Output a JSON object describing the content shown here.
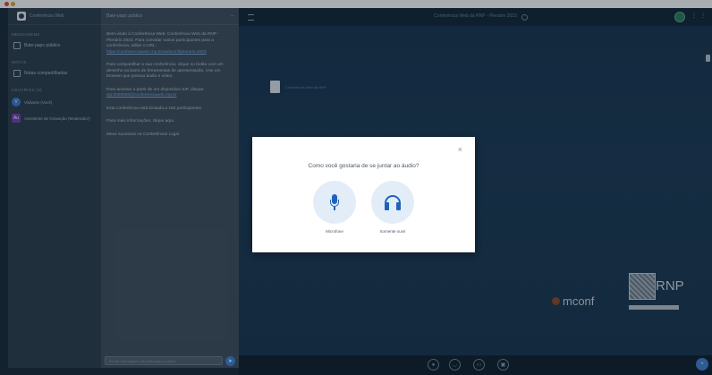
{
  "sidebar": {
    "app_name": "Conferência Web",
    "section_messages": "MENSAGENS",
    "public_chat": "Bate-papo público",
    "section_notes": "NOTAS",
    "shared_notes": "Notas compartilhadas",
    "section_users": "USUÁRIOS (2)",
    "users": [
      {
        "initials": "V",
        "name": "Visitante (Você)"
      },
      {
        "initials": "Au",
        "name": "Assistente de Gravação (Moderador)"
      }
    ]
  },
  "chat": {
    "title": "Bate-papo público",
    "messages": [
      {
        "text": "Bem-vindo à Conferência Web: Conferência Web da RNP - Plenário 2023. Para convidar outros participantes para a conferência, utilize o URL:"
      },
      {
        "link": "https://conferenciaweb.rnp.br/webconf/plenario-2023"
      },
      {
        "text": "Para compartilhar a sua conferência, clique no botão com um desenho na barra de ferramentas de apresentação. Use um browser que possua áudio e vídeo."
      },
      {
        "text": "Para acessar a partir de um dispositivo SIP, disque:"
      },
      {
        "link": "sip:0000000@conferenciaweb.rnp.br"
      },
      {
        "text": "Esta conferência está limitada a 150 participantes."
      },
      {
        "text": "Para mais informações, clique aqui."
      },
      {
        "text": "Meus sucessos na Conferência! Logo!"
      }
    ],
    "input_placeholder": "Enviar mensagem para Bate-papo público"
  },
  "main": {
    "title": "Conferência Web da RNP - Plenário 2023",
    "slide_caption": "Conferência Web da RNP",
    "brand_mconf": "mconf",
    "brand_rnp": "RNP"
  },
  "modal": {
    "question": "Como você gostaria de se juntar ao áudio?",
    "close_glyph": "×",
    "microphone_label": "Microfone",
    "listen_label": "Somente ouvir"
  },
  "icons": {
    "controls": [
      "microphone-icon",
      "headphone-icon",
      "video-icon",
      "screen-share-icon"
    ]
  },
  "colors": {
    "accent": "#1f62bd",
    "sidebar_bg": "#2d3e4d",
    "chat_bg": "#3f4f5e",
    "main_bg": "#1a3650",
    "modal_bg": "#ffffff"
  }
}
